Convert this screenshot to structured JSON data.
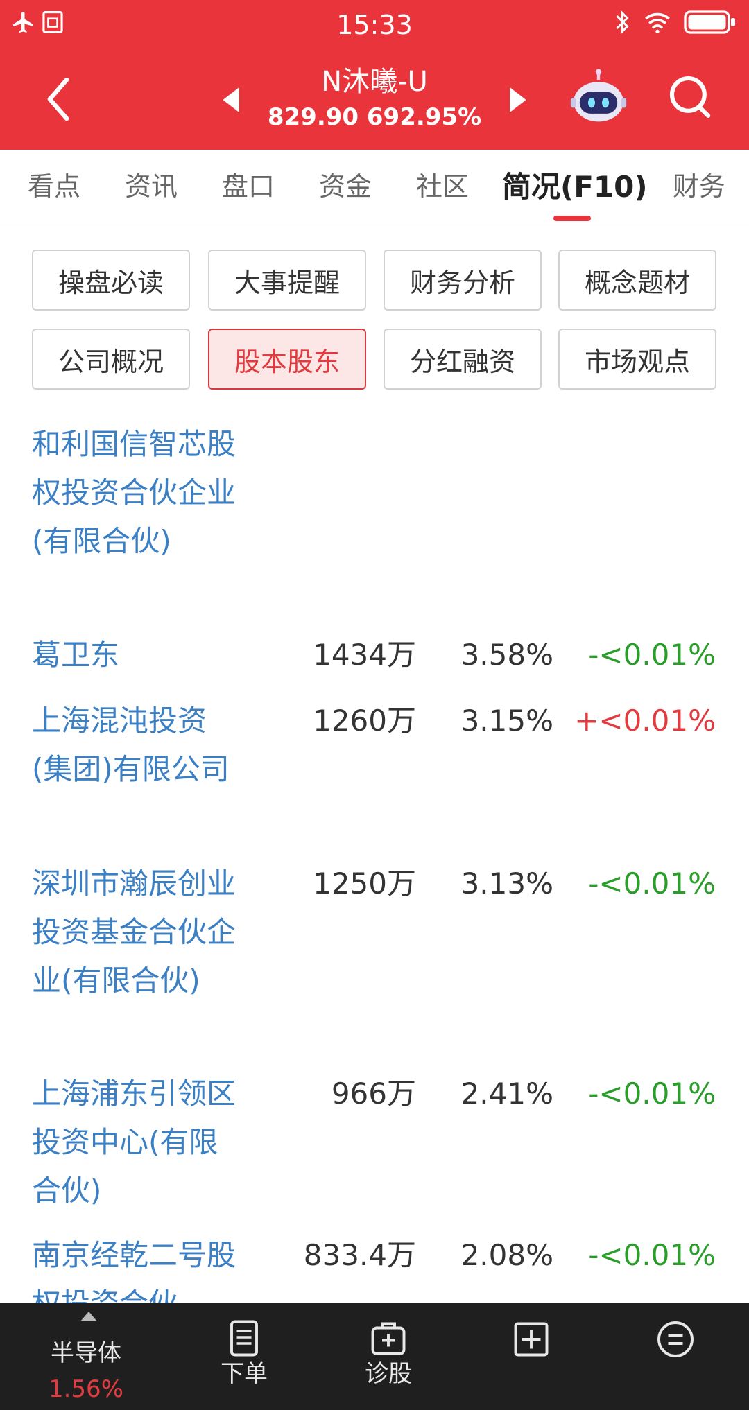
{
  "status_bar": {
    "time": "15:33",
    "left_icons": [
      "airplane-icon",
      "sim-icon"
    ],
    "right_icons": [
      "bluetooth-icon",
      "wifi-icon",
      "battery-icon"
    ]
  },
  "header": {
    "stock_name": "N沐曦-U",
    "price_line": "829.90 692.95%",
    "bg_color": "#e8343a"
  },
  "tabs": [
    {
      "label": "看点"
    },
    {
      "label": "资讯"
    },
    {
      "label": "盘口"
    },
    {
      "label": "资金"
    },
    {
      "label": "社区"
    },
    {
      "label": "简况(F10)",
      "active": true
    },
    {
      "label": "财务"
    }
  ],
  "sub_buttons": [
    {
      "label": "操盘必读"
    },
    {
      "label": "大事提醒"
    },
    {
      "label": "财务分析"
    },
    {
      "label": "概念题材"
    },
    {
      "label": "公司概况"
    },
    {
      "label": "股本股东",
      "selected": true
    },
    {
      "label": "分红融资"
    },
    {
      "label": "市场观点"
    }
  ],
  "shareholders": [
    {
      "name": "和利国信智芯股权投资合伙企业(有限合伙)",
      "shares": "",
      "ratio": "",
      "change": "",
      "trend": ""
    },
    {
      "name": "葛卫东",
      "shares": "1434万",
      "ratio": "3.58%",
      "change": "-<0.01%",
      "trend": "down"
    },
    {
      "name": "上海混沌投资(集团)有限公司",
      "shares": "1260万",
      "ratio": "3.15%",
      "change": "+<0.01%",
      "trend": "up"
    },
    {
      "name": "深圳市瀚辰创业投资基金合伙企业(有限合伙)",
      "shares": "1250万",
      "ratio": "3.13%",
      "change": "-<0.01%",
      "trend": "down"
    },
    {
      "name": "上海浦东引领区投资中心(有限合伙)",
      "shares": "966万",
      "ratio": "2.41%",
      "change": "-<0.01%",
      "trend": "down"
    },
    {
      "name": "南京经乾二号股权投资合伙",
      "shares": "833.4万",
      "ratio": "2.08%",
      "change": "-<0.01%",
      "trend": "down"
    }
  ],
  "bottom_bar": {
    "sector_name": "半导体",
    "sector_change": "1.56%",
    "items": [
      {
        "label": "下单",
        "icon": "document-icon"
      },
      {
        "label": "诊股",
        "icon": "diagnose-icon"
      },
      {
        "label": "",
        "icon": "add-square-icon"
      },
      {
        "label": "",
        "icon": "menu-circle-icon"
      }
    ]
  },
  "colors": {
    "accent": "#e8343a",
    "link": "#3b7fc4",
    "up": "#e23b3f",
    "down": "#2a9d2a"
  }
}
